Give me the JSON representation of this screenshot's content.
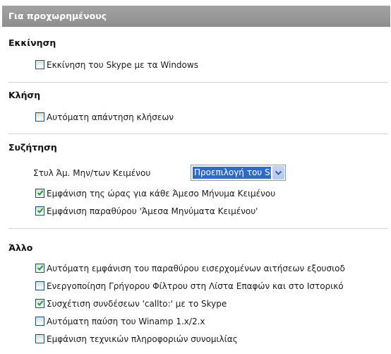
{
  "header": {
    "title": "Για προχωρημένους"
  },
  "sections": [
    {
      "title": "Εκκίνηση",
      "options": [
        {
          "label": "Εκκίνηση του Skype με τα Windows",
          "checked": false
        }
      ]
    },
    {
      "title": "Κλήση",
      "options": [
        {
          "label": "Αυτόματη απάντηση κλήσεων",
          "checked": false
        }
      ]
    },
    {
      "title": "Συζήτηση",
      "style_label": "Στυλ Άμ. Μην/των Κειμένου",
      "style_value": "Προεπιλογή του Skype",
      "options": [
        {
          "label": "Εμφάνιση της ώρας για κάθε Άμεσο Μήνυμα Κειμένου",
          "checked": true
        },
        {
          "label": "Εμφάνιση παραθύρου 'Άμεσα Μηνύματα Κειμένου'",
          "checked": true
        }
      ]
    },
    {
      "title": "Άλλο",
      "options": [
        {
          "label": "Αυτόματη εμφάνιση του παραθύρου εισερχομένων αιτήσεων εξουσιοδ",
          "checked": true
        },
        {
          "label": "Ενεργοποίηση Γρήγορου Φίλτρου στη Λίστα Επαφών και στο Ιστορικό",
          "checked": false
        },
        {
          "label": "Συσχέτιση συνδέσεων 'callto:' με το Skype",
          "checked": true
        },
        {
          "label": "Αυτόματη παύση του Winamp 1.x/2.x",
          "checked": false
        },
        {
          "label": "Εμφάνιση τεχνικών πληροφοριών συνομιλίας",
          "checked": false
        }
      ]
    }
  ],
  "colors": {
    "check": "#21a121",
    "accent": "#316ac5",
    "header": "#999999"
  }
}
